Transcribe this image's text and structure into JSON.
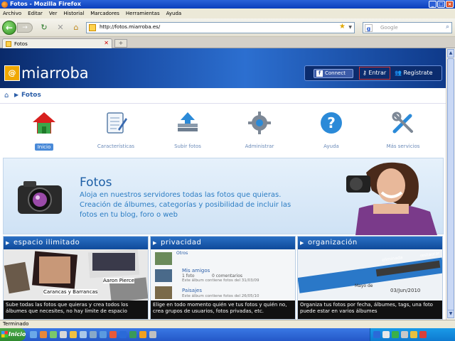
{
  "window": {
    "title": "Fotos - Mozilla Firefox"
  },
  "menu": [
    "Archivo",
    "Editar",
    "Ver",
    "Historial",
    "Marcadores",
    "Herramientas",
    "Ayuda"
  ],
  "nav": {
    "url": "http://fotos.miarroba.es/",
    "search_placeholder": "Google"
  },
  "tabs": [
    {
      "label": "Fotos"
    }
  ],
  "site": {
    "logo_text": "miarroba",
    "logo_mark": "@",
    "connect_label": "Connect",
    "login_label": "Entrar",
    "register_label": "Regístrate",
    "breadcrumb": "Fotos",
    "nav_items": [
      {
        "label": "Inicio",
        "icon": "home-icon"
      },
      {
        "label": "Características",
        "icon": "notebook-icon"
      },
      {
        "label": "Subir fotos",
        "icon": "upload-icon"
      },
      {
        "label": "Administrar",
        "icon": "gear-icon"
      },
      {
        "label": "Ayuda",
        "icon": "help-icon"
      },
      {
        "label": "Más servicios",
        "icon": "tools-icon"
      }
    ],
    "banner": {
      "title": "Fotos",
      "description": "Aloja en nuestros servidores todas las fotos que quieras. Creación de álbumes, categorías y posibilidad de incluir las fotos en tu blog, foro o web"
    },
    "features": [
      {
        "title": "espacio ilimitado",
        "caption": "Sube todas las fotos que quieras y crea todos los álbumes que necesites, no hay límite de espacio",
        "img_labels": [
          "Aaron Pierce",
          "Carancas y Barrancas"
        ]
      },
      {
        "title": "privacidad",
        "caption": "Elige en todo momento quién ve tus fotos y quién no, crea grupos de usuarios, fotos privadas, etc.",
        "img_labels": [
          "Otros",
          "Mis amigos",
          "Paisajes",
          "1 foto",
          "0 comentarios",
          "Este álbum contiene fotos del 31/03/09",
          "Este álbum contiene fotos del 26/05/10"
        ]
      },
      {
        "title": "organización",
        "caption": "Organiza tus fotos por fecha, álbumes, tags, una foto puede estar en varios álbumes",
        "img_labels": [
          "eliminada",
          "restaurar",
          "Mayo de",
          "03/Jun/2010"
        ]
      }
    ]
  },
  "status": {
    "text": "Terminado"
  },
  "taskbar": {
    "start_label": "Inicio"
  },
  "colors": {
    "accent": "#1d5fa6",
    "header_dark": "#0a2a6a",
    "link": "#2b7cc3"
  }
}
